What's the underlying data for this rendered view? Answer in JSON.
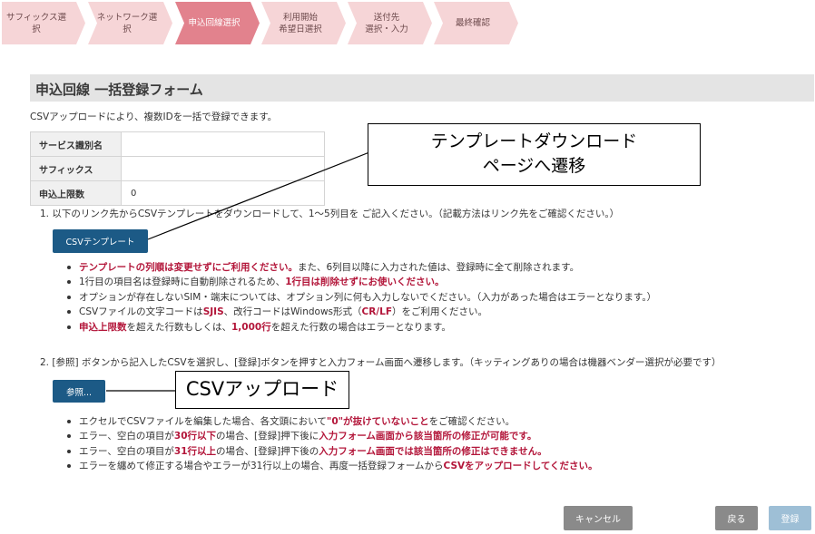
{
  "steps": [
    {
      "line1": "サフィックス選",
      "line2": "択"
    },
    {
      "line1": "ネットワーク選",
      "line2": "択"
    },
    {
      "line1": "申込回線選択",
      "line2": ""
    },
    {
      "line1": "利用開始",
      "line2": "希望日選択"
    },
    {
      "line1": "送付先",
      "line2": "選択・入力"
    },
    {
      "line1": "最終確認",
      "line2": ""
    }
  ],
  "header": {
    "title": "申込回線 一括登録フォーム",
    "subtitle": "CSVアップロードにより、複数IDを一括で登録できます。"
  },
  "info_table": [
    {
      "label": "サービス識別名",
      "value": ""
    },
    {
      "label": "サフィックス",
      "value": ""
    },
    {
      "label": "申込上限数",
      "value": "0"
    }
  ],
  "section1": {
    "text": "1. 以下のリンク先からCSVテンプレートをダウンロードして、1～5列目を ご記入ください。（記載方法はリンク先をご確認ください。）",
    "button": "CSVテンプレート",
    "bullets": [
      [
        {
          "t": "テンプレートの列順は変更せずにご利用ください。",
          "red": true
        },
        {
          "t": "また、6列目以降に入力された値は、登録時に全て削除されます。",
          "red": false
        }
      ],
      [
        {
          "t": "1行目の項目名は登録時に自動削除されるため、",
          "red": false
        },
        {
          "t": "1行目は削除せずにお使いください。",
          "red": true
        }
      ],
      [
        {
          "t": "オプションが存在しないSIM・端末については、オプション列に何も入力しないでください。（入力があった場合はエラーとなります。）",
          "red": false
        }
      ],
      [
        {
          "t": "CSVファイルの文字コードは",
          "red": false
        },
        {
          "t": "SJIS",
          "red": true
        },
        {
          "t": "、改行コードはWindows形式（",
          "red": false
        },
        {
          "t": "CR/LF",
          "red": true
        },
        {
          "t": "）をご利用ください。",
          "red": false
        }
      ],
      [
        {
          "t": "申込上限数",
          "red": true
        },
        {
          "t": "を超えた行数もしくは、",
          "red": false
        },
        {
          "t": "1,000行",
          "red": true
        },
        {
          "t": "を超えた行数の場合はエラーとなります。",
          "red": false
        }
      ]
    ]
  },
  "section2": {
    "text": "2. [参照] ボタンから記入したCSVを選択し、[登録]ボタンを押すと入力フォーム画面へ遷移します。（キッティングありの場合は機器ベンダー選択が必要です）",
    "button": "参照...",
    "bullets": [
      [
        {
          "t": "エクセルでCSVファイルを編集した場合、各文頭において",
          "red": false
        },
        {
          "t": "\"0\"が抜けていないこと",
          "red": true
        },
        {
          "t": "をご確認ください。",
          "red": false
        }
      ],
      [
        {
          "t": "エラー、空白の項目が",
          "red": false
        },
        {
          "t": "30行以下",
          "red": true
        },
        {
          "t": "の場合、[登録]押下後に",
          "red": false
        },
        {
          "t": "入力フォーム画面から該当箇所の修正が可能です。",
          "red": true
        }
      ],
      [
        {
          "t": "エラー、空白の項目が",
          "red": false
        },
        {
          "t": "31行以上",
          "red": true
        },
        {
          "t": "の場合、[登録]押下後の",
          "red": false
        },
        {
          "t": "入力フォーム画面では該当箇所の修正はできません。",
          "red": true
        }
      ],
      [
        {
          "t": "エラーを纏めて修正する場合やエラーが31行以上の場合、再度一括登録フォームから",
          "red": false
        },
        {
          "t": "CSVをアップロードしてください。",
          "red": true
        }
      ]
    ]
  },
  "callouts": {
    "template": {
      "line1": "テンプレートダウンロード",
      "line2": "ページへ遷移"
    },
    "upload": "CSVアップロード"
  },
  "footer": {
    "cancel": "キャンセル",
    "back": "戻る",
    "register": "登録"
  },
  "colors": {
    "step_inactive": "#f6d5d7",
    "step_active": "#e2828d",
    "primary_button": "#1c5a86",
    "emphasis_red": "#b3163a",
    "gray_button": "#8a8a8a",
    "disabled_button": "#9ebfd6"
  }
}
